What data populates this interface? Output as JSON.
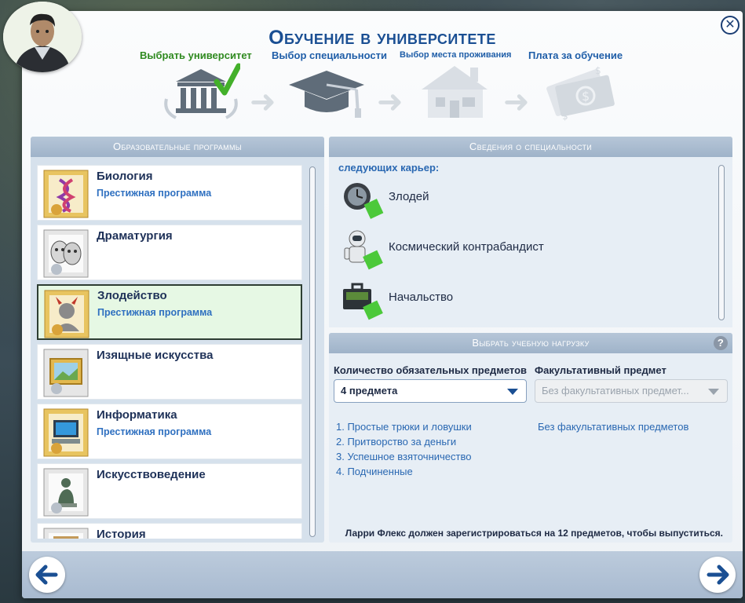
{
  "header": {
    "title": "Обучение в университете",
    "close_label": "✕",
    "steps": [
      {
        "label": "Выбрать университет",
        "state": "done"
      },
      {
        "label": "Выбор специальности",
        "state": "current"
      },
      {
        "label": "Выбор места проживания",
        "state": "current"
      },
      {
        "label": "Плата за обучение",
        "state": "current"
      }
    ]
  },
  "programs": {
    "heading": "Образовательные программы",
    "items": [
      {
        "name": "Биология",
        "tag": "Престижная программа",
        "icon": "dna-icon"
      },
      {
        "name": "Драматургия",
        "tag": "",
        "icon": "theater-masks-icon"
      },
      {
        "name": "Злодейство",
        "tag": "Престижная программа",
        "icon": "villain-icon",
        "selected": true
      },
      {
        "name": "Изящные искусства",
        "tag": "",
        "icon": "painting-icon"
      },
      {
        "name": "Информатика",
        "tag": "Престижная программа",
        "icon": "computer-icon"
      },
      {
        "name": "Искусствоведение",
        "tag": "",
        "icon": "statue-icon"
      },
      {
        "name": "История",
        "tag": "",
        "icon": "scroll-icon"
      }
    ]
  },
  "details": {
    "heading": "Сведения о специальности",
    "intro": "следующих карьер:",
    "careers": [
      {
        "label": "Злодей",
        "icon": "watch-icon"
      },
      {
        "label": "Космический контрабандист",
        "icon": "astronaut-icon"
      },
      {
        "label": "Начальство",
        "icon": "briefcase-icon"
      }
    ]
  },
  "load": {
    "heading": "Выбрать учебную нагрузку",
    "help": "?",
    "required_label": "Количество обязательных предметов",
    "required_value": "4 предмета",
    "elective_label": "Факультативный предмет",
    "elective_value": "Без факультативных предмет...",
    "subjects": [
      "1.  Простые трюки и ловушки",
      "2.  Притворство за деньги",
      "3.  Успешное взяточничество",
      "4.  Подчиненные"
    ],
    "no_elective": "Без факультативных предметов",
    "footnote": "Ларри Флекс должен зарегистрироваться на 12 предметов, чтобы выпуститься."
  },
  "colors": {
    "accent": "#1a4f93",
    "done": "#2f8a1f",
    "selected_bg": "#e6f8e4"
  }
}
